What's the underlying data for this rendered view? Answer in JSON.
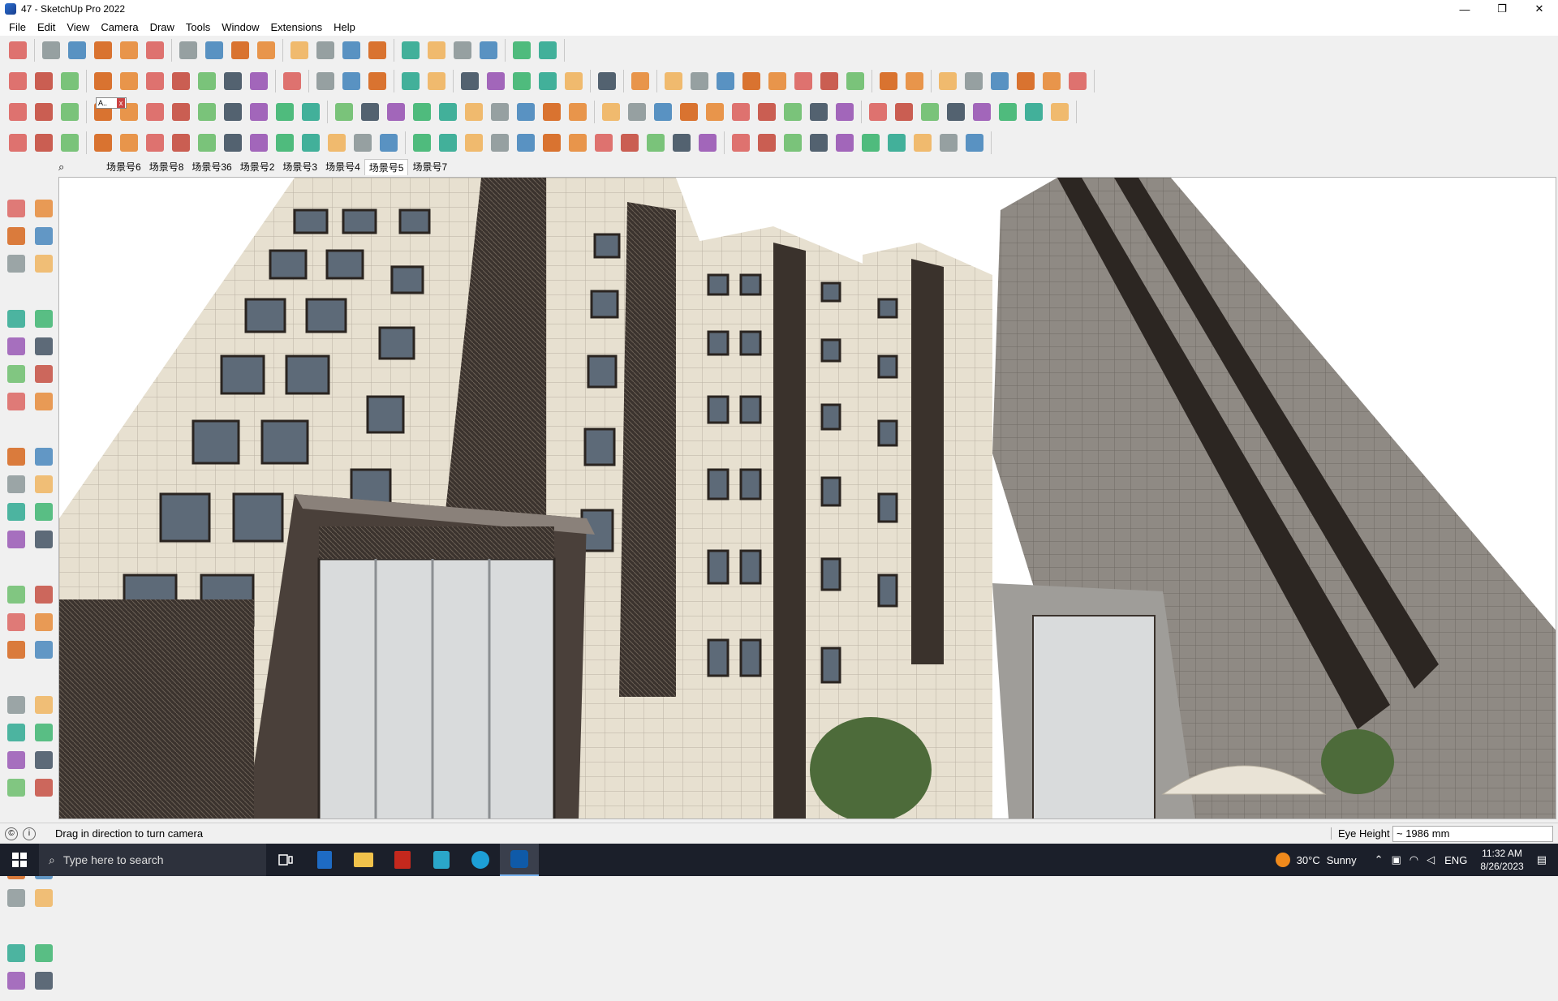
{
  "window": {
    "title": "47 - SketchUp Pro 2022",
    "minimize": "—",
    "maximize": "❐",
    "close": "✕"
  },
  "menubar": [
    "File",
    "Edit",
    "View",
    "Camera",
    "Draw",
    "Tools",
    "Window",
    "Extensions",
    "Help"
  ],
  "toolbar": {
    "text_tool_label": "A..",
    "close_glyph": "x"
  },
  "scenes": {
    "tabs": [
      "场景号6",
      "场景号8",
      "场景号36",
      "场景号2",
      "场景号3",
      "场景号4",
      "场景号5",
      "场景号7"
    ],
    "active_index": 6
  },
  "status": {
    "hint": "Drag in direction to turn camera",
    "vcb_label": "Eye Height",
    "vcb_value": "~ 1986 mm"
  },
  "taskbar": {
    "search_placeholder": "Type here to search",
    "weather_temp": "30°C",
    "weather_text": "Sunny",
    "language": "ENG",
    "time": "11:32 AM",
    "date": "8/26/2023"
  },
  "colors": {
    "accent": "#0078d7",
    "facade": "#e8e1d2",
    "dark": "#3a322c"
  }
}
